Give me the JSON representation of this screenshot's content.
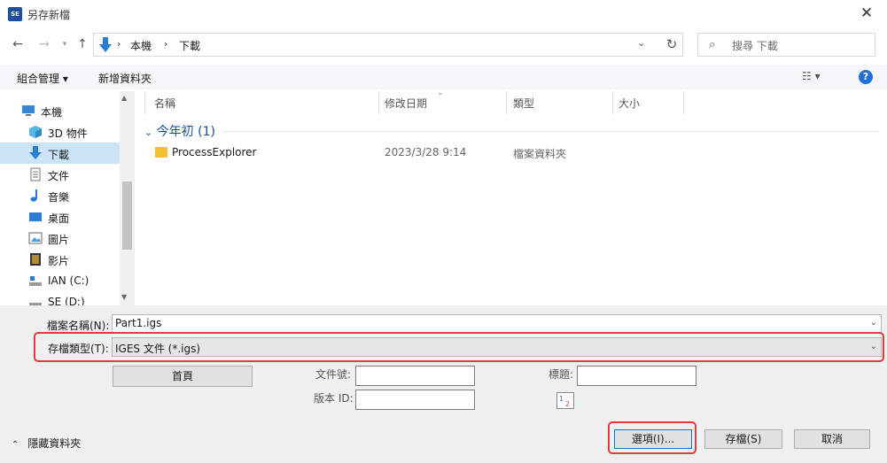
{
  "window": {
    "title": "另存新檔",
    "app_icon_text": "SE",
    "close_glyph": "✕"
  },
  "address_bar": {
    "breadcrumbs": [
      "本機",
      "下載"
    ],
    "search_placeholder": "搜尋 下載"
  },
  "toolbar": {
    "organize_label": "組合管理 ▾",
    "new_folder_label": "新增資料夾",
    "view_label": "☷ ▾",
    "help_glyph": "?"
  },
  "nav": {
    "items": [
      {
        "label": "本機",
        "icon": "computer-icon"
      },
      {
        "label": "3D 物件",
        "icon": "cube-icon"
      },
      {
        "label": "下載",
        "icon": "download-icon",
        "selected": true
      },
      {
        "label": "文件",
        "icon": "document-icon"
      },
      {
        "label": "音樂",
        "icon": "music-icon"
      },
      {
        "label": "桌面",
        "icon": "desktop-icon"
      },
      {
        "label": "圖片",
        "icon": "pictures-icon"
      },
      {
        "label": "影片",
        "icon": "video-icon"
      },
      {
        "label": "IAN (C:)",
        "icon": "drive-icon"
      },
      {
        "label": "SE (D:)",
        "icon": "drive-icon"
      }
    ]
  },
  "file_list": {
    "columns": [
      "名稱",
      "修改日期",
      "類型",
      "大小"
    ],
    "group": "今年初 (1)",
    "rows": [
      {
        "name": "ProcessExplorer",
        "modified": "2023/3/28 9:14",
        "type": "檔案資料夾",
        "size": ""
      }
    ]
  },
  "form": {
    "filename_label": "檔案名稱(N):",
    "filename_value": "Part1.igs",
    "filetype_label": "存檔類型(T):",
    "filetype_value": "IGES 文件 (*.igs)",
    "homepage_button": "首頁",
    "doc_number_label": "文件號:",
    "version_id_label": "版本 ID:",
    "title_label": "標題:",
    "doc_number_value": "",
    "version_id_value": "",
    "title_value": ""
  },
  "footer": {
    "hide_folders_label": "隱藏資料夾",
    "options_button": "選項(I)...",
    "save_button": "存檔(S)",
    "cancel_button": "取消"
  },
  "colors": {
    "highlight": "#e03c3c",
    "selected_nav": "#cce4f7",
    "accent": "#1e6fd6"
  }
}
